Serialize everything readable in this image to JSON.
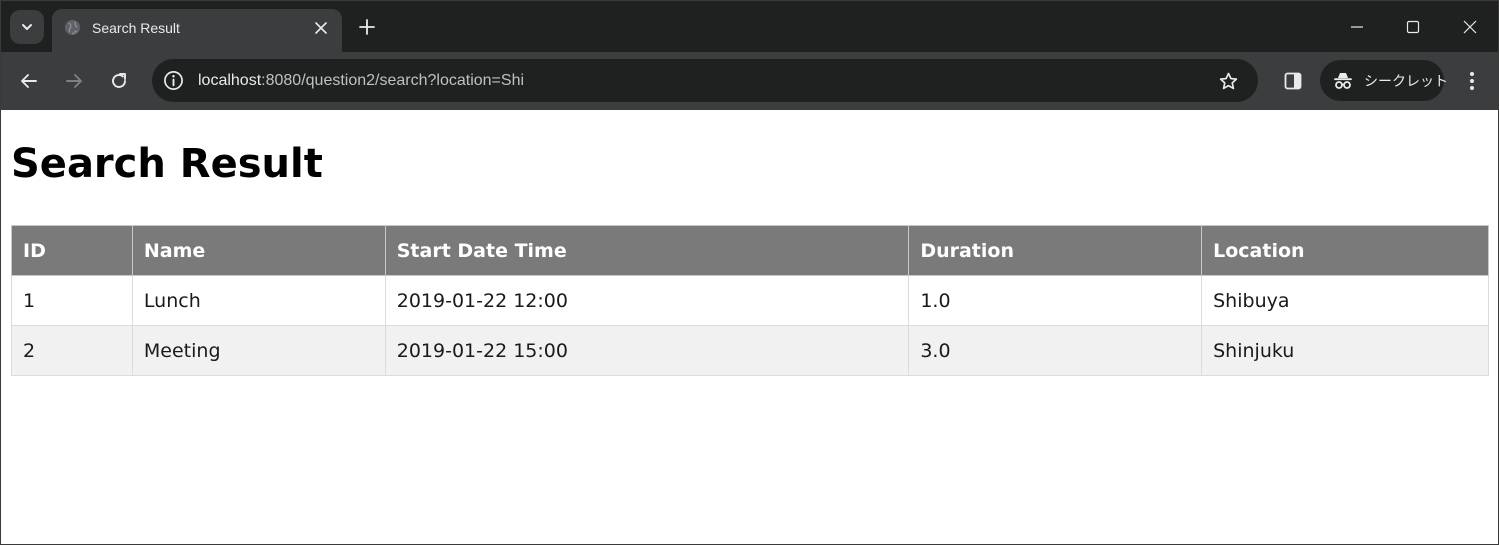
{
  "browser": {
    "tab": {
      "title": "Search Result",
      "favicon": "globe-icon"
    },
    "address_bar": {
      "host": "localhost",
      "rest": ":8080/question2/search?location=Shi"
    },
    "incognito_label": "シークレット",
    "colors": {
      "frame": "#1f2020",
      "toolbar": "#3c3d3e",
      "text": "#e8eaed"
    }
  },
  "page": {
    "title": "Search Result",
    "table": {
      "headers": [
        "ID",
        "Name",
        "Start Date Time",
        "Duration",
        "Location"
      ],
      "rows": [
        [
          "1",
          "Lunch",
          "2019-01-22 12:00",
          "1.0",
          "Shibuya"
        ],
        [
          "2",
          "Meeting",
          "2019-01-22 15:00",
          "3.0",
          "Shinjuku"
        ]
      ],
      "colors": {
        "header_bg": "#7a7a7a",
        "header_text": "#ffffff",
        "alt_row_bg": "#f1f1f1"
      }
    }
  }
}
